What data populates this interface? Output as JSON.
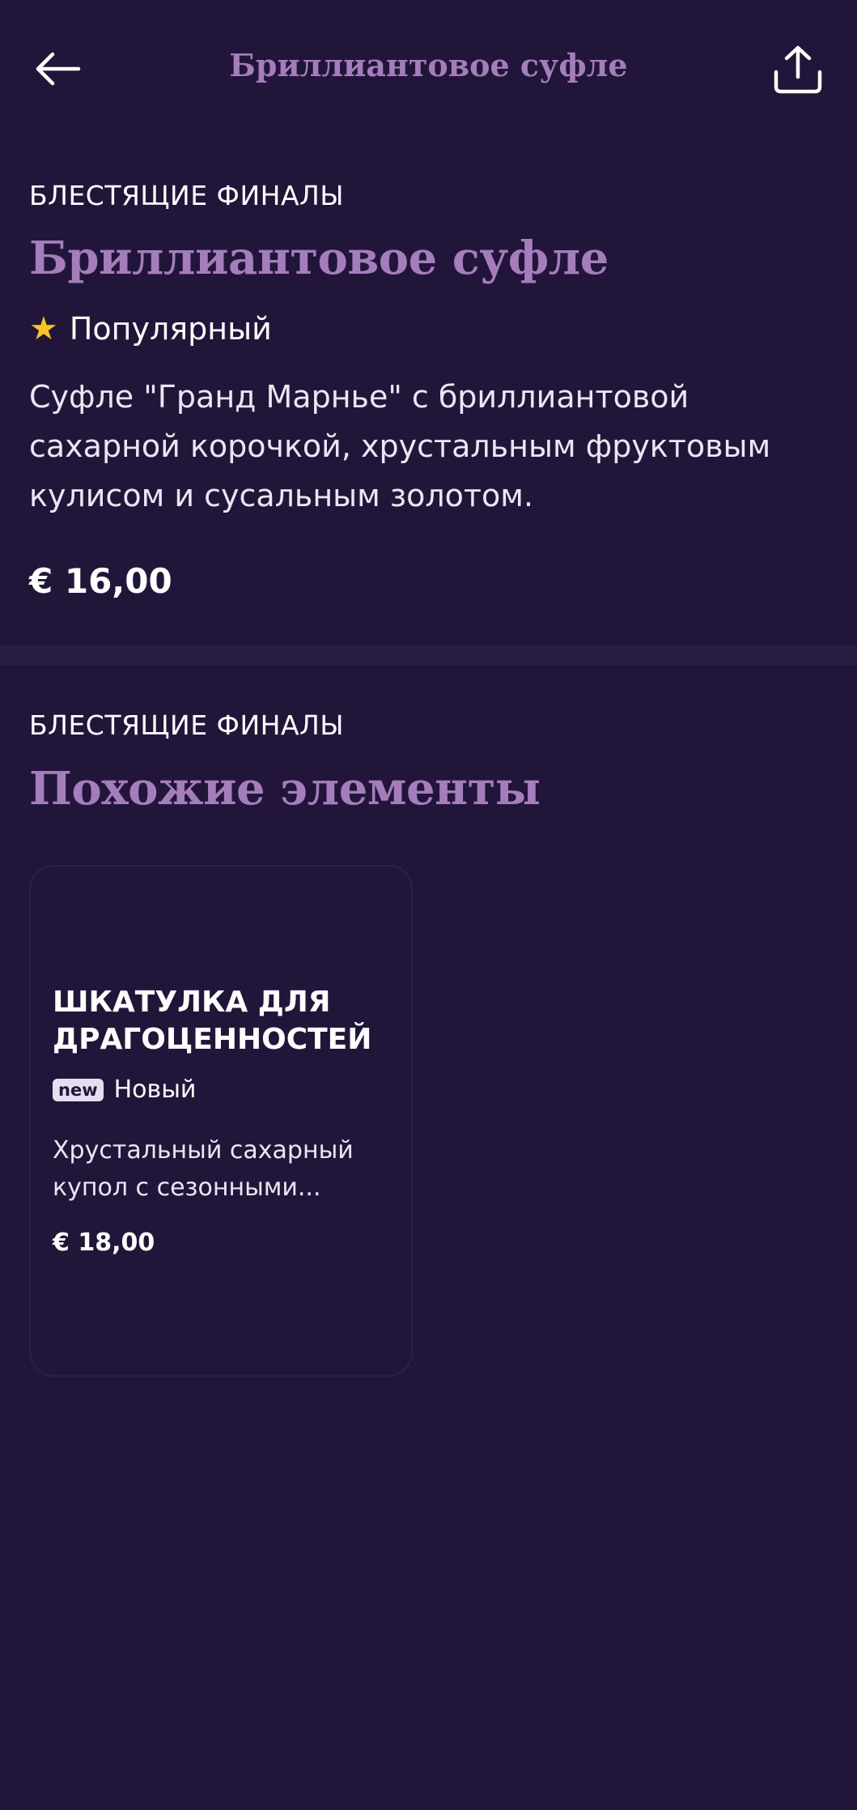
{
  "header": {
    "title": "Бриллиантовое суфле",
    "back_icon": "arrow-left-icon",
    "share_icon": "share-upload-icon"
  },
  "item": {
    "category": "БЛЕСТЯЩИЕ ФИНАЛЫ",
    "title": "Бриллиантовое суфле",
    "tag_icon": "star-icon",
    "tag": "Популярный",
    "description": "Суфле \"Гранд Марнье\" с бриллиантовой сахарной корочкой, хрустальным фруктовым кулисом и сусальным золотом.",
    "price": "€ 16,00"
  },
  "related": {
    "category": "БЛЕСТЯЩИЕ ФИНАЛЫ",
    "title": "Похожие элементы",
    "cards": [
      {
        "title": "ШКАТУЛКА ДЛЯ ДРАГОЦЕННОСТЕЙ",
        "badge": "new",
        "tag": "Новый",
        "description": "Хрустальный сахарный купол с сезонными...",
        "price": "€ 18,00"
      }
    ]
  },
  "colors": {
    "background": "#21163a",
    "accent": "#a57dbc",
    "star": "#f7c326",
    "divider": "#281d42"
  }
}
